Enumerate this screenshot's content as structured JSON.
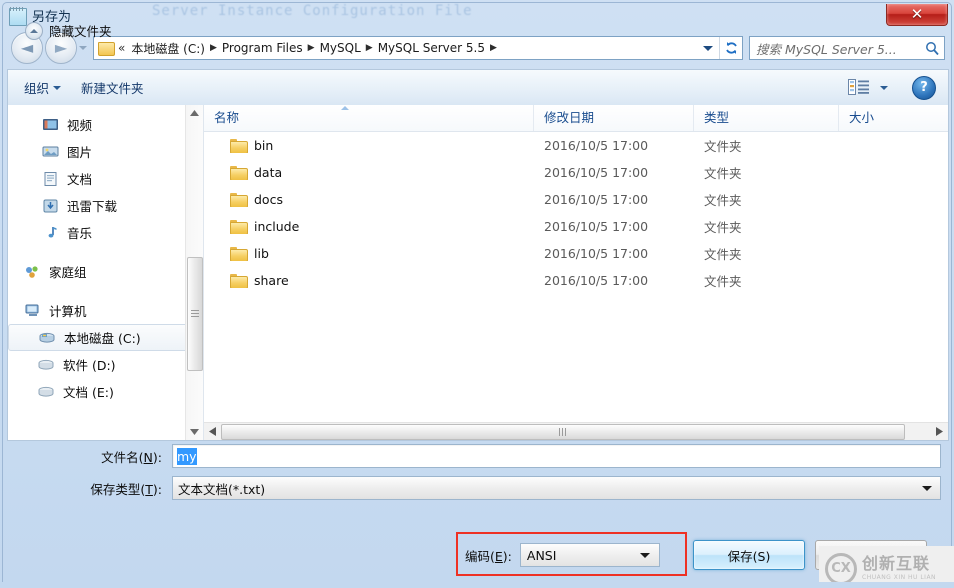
{
  "background_window": {
    "title": "Server Instance Configuration File"
  },
  "dialog": {
    "title": "另存为",
    "icon": "notepad-icon",
    "close_label": "✕"
  },
  "navigation": {
    "back_label": "◄",
    "forward_label": "►",
    "recent_dropdown": "▼",
    "address": {
      "folder_icon": "folder-icon",
      "leading_ellipsis": "«",
      "crumbs": [
        {
          "label": "本地磁盘 (C:)"
        },
        {
          "label": "Program Files"
        },
        {
          "label": "MySQL"
        },
        {
          "label": "MySQL Server 5.5"
        }
      ],
      "separator": "▶",
      "dropdown": "▼",
      "refresh_icon": "refresh-icon"
    },
    "search": {
      "placeholder": "搜索 MySQL Server 5...",
      "icon": "search-icon"
    }
  },
  "toolbar": {
    "organize_label": "组织",
    "new_folder_label": "新建文件夹",
    "view_icon": "view-options-icon",
    "view_dropdown": "▼",
    "help_label": "?"
  },
  "sidebar": {
    "library_items": [
      {
        "label": "视频",
        "icon": "video-icon"
      },
      {
        "label": "图片",
        "icon": "pictures-icon"
      },
      {
        "label": "文档",
        "icon": "documents-icon"
      },
      {
        "label": "迅雷下载",
        "icon": "downloads-icon"
      },
      {
        "label": "音乐",
        "icon": "music-icon"
      }
    ],
    "homegroup": {
      "label": "家庭组",
      "icon": "homegroup-icon"
    },
    "computer": {
      "label": "计算机",
      "icon": "computer-icon"
    },
    "drives": [
      {
        "label": "本地磁盘 (C:)",
        "icon": "system-drive-icon",
        "selected": true
      },
      {
        "label": "软件 (D:)",
        "icon": "drive-icon",
        "selected": false
      },
      {
        "label": "文档 (E:)",
        "icon": "drive-icon",
        "selected": false
      }
    ],
    "scroll_up": "▲",
    "scroll_down": "▼"
  },
  "filelist": {
    "columns": [
      {
        "label": "名称",
        "sorted": "asc"
      },
      {
        "label": "修改日期"
      },
      {
        "label": "类型"
      },
      {
        "label": "大小"
      }
    ],
    "rows": [
      {
        "name": "bin",
        "date": "2016/10/5 17:00",
        "type": "文件夹",
        "size": ""
      },
      {
        "name": "data",
        "date": "2016/10/5 17:00",
        "type": "文件夹",
        "size": ""
      },
      {
        "name": "docs",
        "date": "2016/10/5 17:00",
        "type": "文件夹",
        "size": ""
      },
      {
        "name": "include",
        "date": "2016/10/5 17:00",
        "type": "文件夹",
        "size": ""
      },
      {
        "name": "lib",
        "date": "2016/10/5 17:00",
        "type": "文件夹",
        "size": ""
      },
      {
        "name": "share",
        "date": "2016/10/5 17:00",
        "type": "文件夹",
        "size": ""
      }
    ],
    "hscroll_left": "◄",
    "hscroll_right": "►"
  },
  "form": {
    "filename_label_pre": "文件名(",
    "filename_label_key": "N",
    "filename_label_post": "):",
    "filename_value": "my",
    "filetype_label_pre": "保存类型(",
    "filetype_label_key": "T",
    "filetype_label_post": "):",
    "filetype_value": "文本文档(*.txt)"
  },
  "footer": {
    "hide_folders_label": "隐藏文件夹",
    "encoding_label_pre": "编码(",
    "encoding_label_key": "E",
    "encoding_label_post": "):",
    "encoding_value": "ANSI",
    "save_label": "保存(S)",
    "cancel_label": ""
  },
  "annotation": {
    "highlight_color": "#ee3124"
  },
  "watermark": {
    "logo": "CX",
    "title": "创新互联",
    "subtitle": "CHUANG XIN HU LIAN"
  }
}
